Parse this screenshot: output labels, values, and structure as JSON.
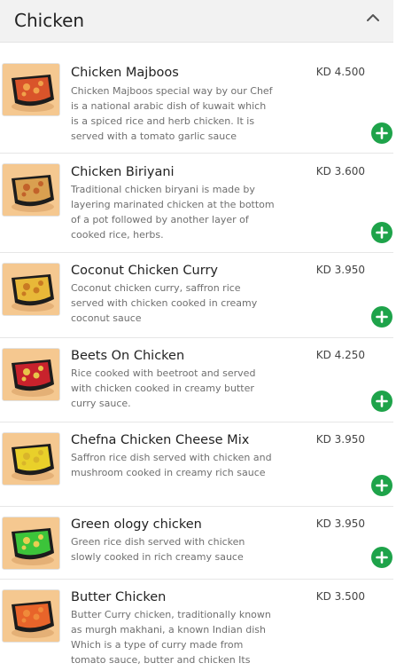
{
  "section": {
    "title": "Chicken",
    "collapse_icon": "chevron-up-icon"
  },
  "items": [
    {
      "name": "Chicken Majboos",
      "price": "KD 4.500",
      "description": "Chicken Majboos special way by our Chef is a national arabic dish of kuwait which is a spiced rice and herb chicken. It is served with a tomato garlic sauce",
      "food_color": "#d9542a",
      "accent_color": "#f0a24a"
    },
    {
      "name": "Chicken Biriyani",
      "price": "KD 3.600",
      "description": "Traditional chicken biryani is made by layering marinated chicken at the bottom of a pot followed by another layer of cooked rice, herbs.",
      "food_color": "#d9a050",
      "accent_color": "#c2622a"
    },
    {
      "name": "Coconut Chicken Curry",
      "price": "KD 3.950",
      "description": "Coconut chicken curry, saffron rice served with chicken cooked in creamy coconut sauce",
      "food_color": "#e8b838",
      "accent_color": "#c97a22"
    },
    {
      "name": "Beets On Chicken",
      "price": "KD 4.250",
      "description": "Rice cooked with beetroot and served with chicken cooked in creamy butter curry sauce.",
      "food_color": "#c8222c",
      "accent_color": "#e8c44a"
    },
    {
      "name": "Chefna Chicken Cheese Mix",
      "price": "KD 3.950",
      "description": "Saffron rice dish served with chicken and mushroom cooked in creamy rich sauce",
      "food_color": "#e9d02a",
      "accent_color": "#d9b52a"
    },
    {
      "name": "Green ology chicken",
      "price": "KD 3.950",
      "description": "Green rice dish served with chicken slowly cooked in rich creamy sauce",
      "food_color": "#3cc43a",
      "accent_color": "#e8cf52"
    },
    {
      "name": "Butter Chicken",
      "price": "KD 3.500",
      "description": "Butter Curry chicken, traditionally known as murgh makhani, a known Indian dish Which is a type of curry made from tomato sauce, butter and chicken Its sauce is known for its rich",
      "food_color": "#e8642a",
      "accent_color": "#f08a3a"
    }
  ],
  "colors": {
    "accent_green": "#1ea34a",
    "header_bg": "#f2f2f2",
    "thumb_bg": "#f5c890"
  },
  "icons": {
    "add": "plus-circle-icon",
    "collapse": "chevron-up-icon"
  }
}
